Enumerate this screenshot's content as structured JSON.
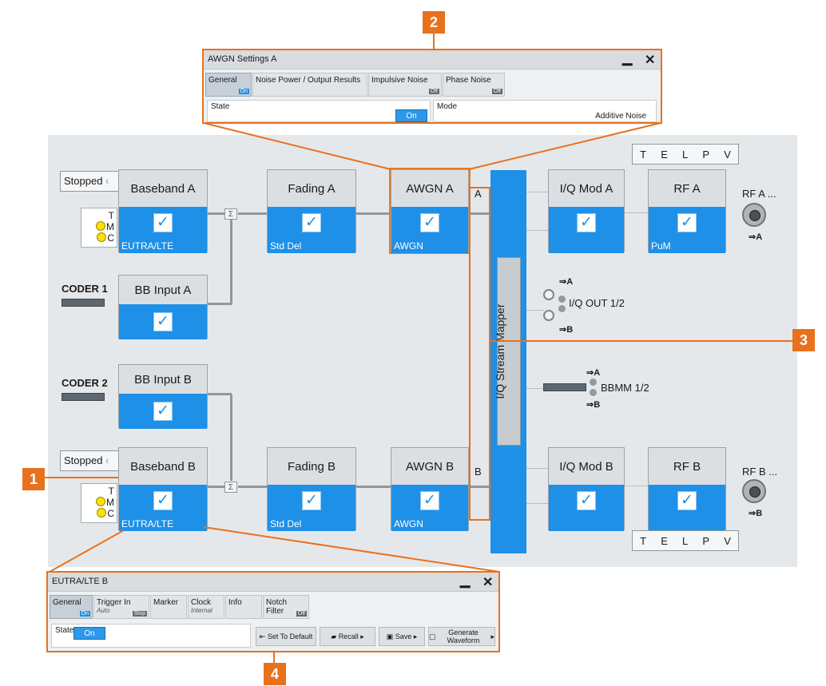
{
  "callouts": [
    "1",
    "2",
    "3",
    "4"
  ],
  "awgn_dialog": {
    "title": "AWGN Settings A",
    "tabs": [
      {
        "label": "General",
        "state": "On"
      },
      {
        "label": "Noise Power / Output Results",
        "state": ""
      },
      {
        "label": "Impulsive Noise",
        "state": "Off"
      },
      {
        "label": "Phase Noise",
        "state": "Off"
      }
    ],
    "state_label": "State",
    "state_value": "On",
    "mode_label": "Mode",
    "mode_value": "Additive Noise"
  },
  "eutra_dialog": {
    "title": "EUTRA/LTE B",
    "tabs": [
      {
        "label": "General",
        "sub": "",
        "state": "On"
      },
      {
        "label": "Trigger In",
        "sub": "Auto",
        "state": "Stop"
      },
      {
        "label": "Marker",
        "sub": "",
        "state": ""
      },
      {
        "label": "Clock",
        "sub": "Internal",
        "state": ""
      },
      {
        "label": "Info",
        "sub": "",
        "state": ""
      },
      {
        "label": "Notch Filter",
        "sub": "",
        "state": "Off"
      }
    ],
    "state_label": "State",
    "state_value": "On",
    "buttons": {
      "set_default": "Set To Default",
      "recall": "Recall",
      "save": "Save",
      "generate": "Generate Waveform"
    }
  },
  "diagram": {
    "stopped": "Stopped",
    "t": "T",
    "m": "M",
    "c": "C",
    "baseband_a": {
      "title": "Baseband A",
      "sub": "EUTRA/LTE"
    },
    "baseband_b": {
      "title": "Baseband B",
      "sub": "EUTRA/LTE"
    },
    "bb_input_a": {
      "title": "BB Input A"
    },
    "bb_input_b": {
      "title": "BB Input B"
    },
    "coder1": "CODER 1",
    "coder2": "CODER 2",
    "fading_a": {
      "title": "Fading A",
      "sub": "Std Del"
    },
    "fading_b": {
      "title": "Fading B",
      "sub": "Std Del"
    },
    "awgn_a": {
      "title": "AWGN A",
      "sub": "AWGN"
    },
    "awgn_b": {
      "title": "AWGN B",
      "sub": "AWGN"
    },
    "stream_a": "A",
    "stream_b": "B",
    "mapper": "I/Q Stream Mapper",
    "iq_mod_a": {
      "title": "I/Q Mod A"
    },
    "iq_mod_b": {
      "title": "I/Q Mod B"
    },
    "rf_a": {
      "title": "RF A",
      "sub": "PuM"
    },
    "rf_b": {
      "title": "RF B",
      "sub": ""
    },
    "rf_a_out": "RF A ...",
    "rf_b_out": "RF B ...",
    "arrow_a": "⇒A",
    "arrow_b": "⇒B",
    "iq_out": "I/Q OUT 1/2",
    "bbmm": "BBMM 1/2",
    "tel": [
      "T",
      "E",
      "L",
      "P",
      "V"
    ]
  }
}
